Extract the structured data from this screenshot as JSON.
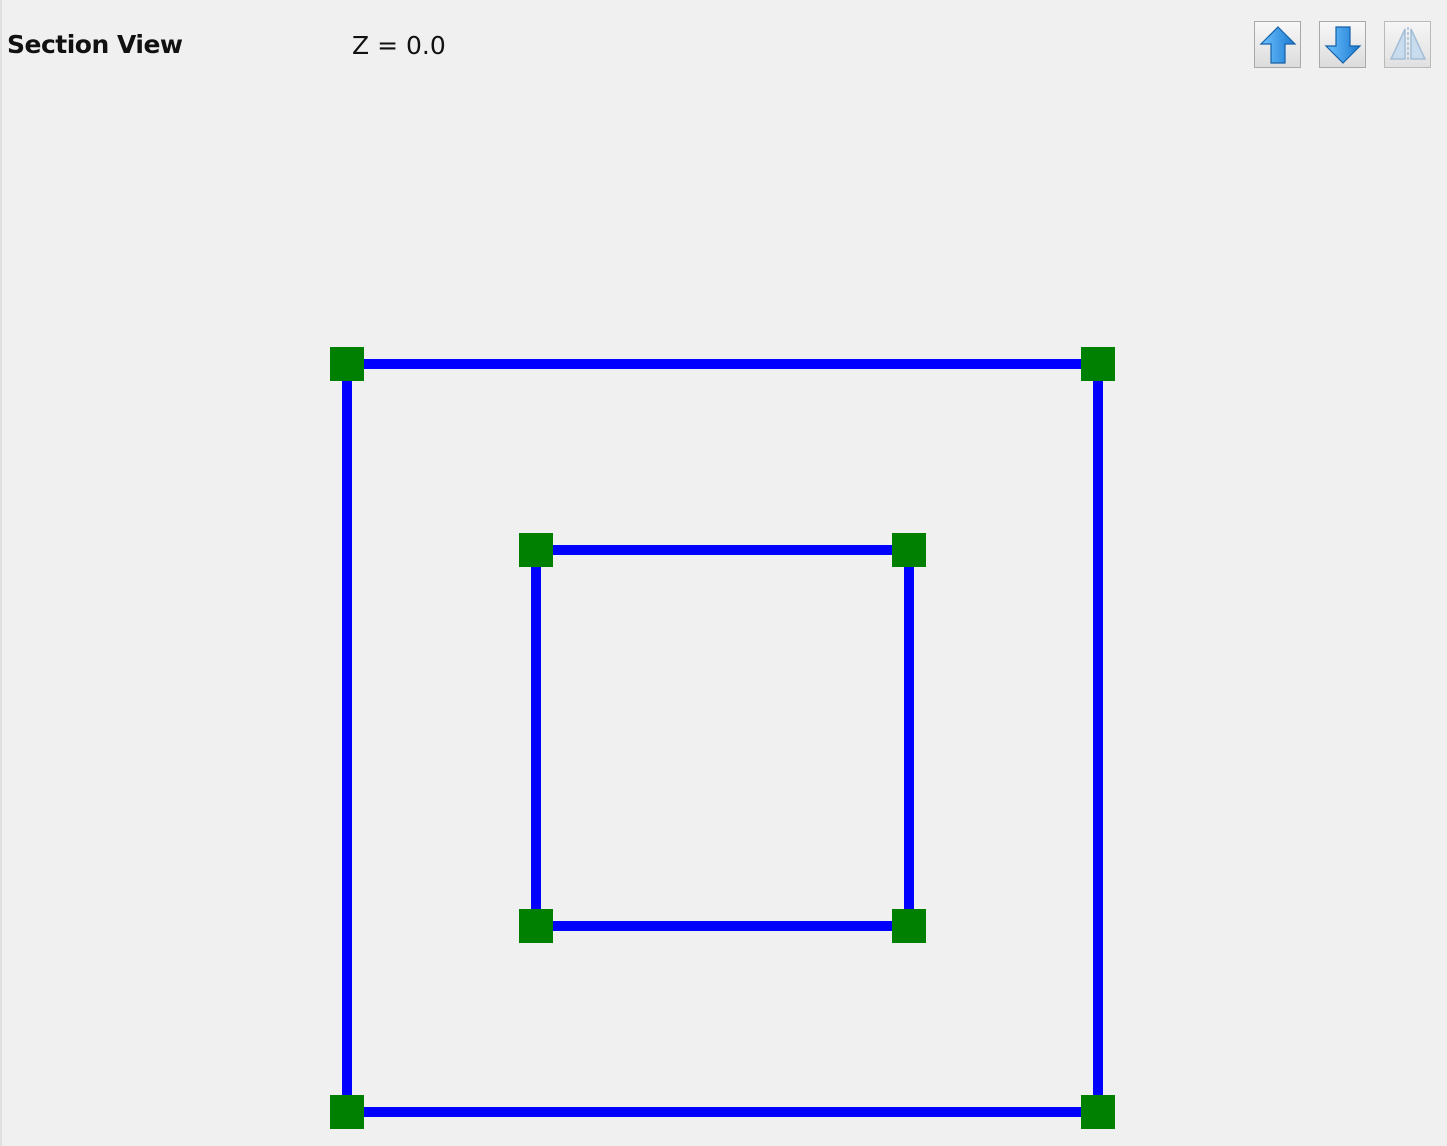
{
  "header": {
    "title": "Section View",
    "z_readout": "Z = 0.0"
  },
  "toolbar": {
    "buttons": [
      {
        "name": "move-up-button",
        "icon": "arrow-up-icon",
        "enabled": true
      },
      {
        "name": "move-down-button",
        "icon": "arrow-down-icon",
        "enabled": true
      },
      {
        "name": "mirror-button",
        "icon": "mirror-icon",
        "enabled": false
      }
    ]
  },
  "colors": {
    "background": "#f0f0f0",
    "edge": "#0000ff",
    "vertex": "#008000",
    "icon_blue": "#2f8fe0"
  }
}
